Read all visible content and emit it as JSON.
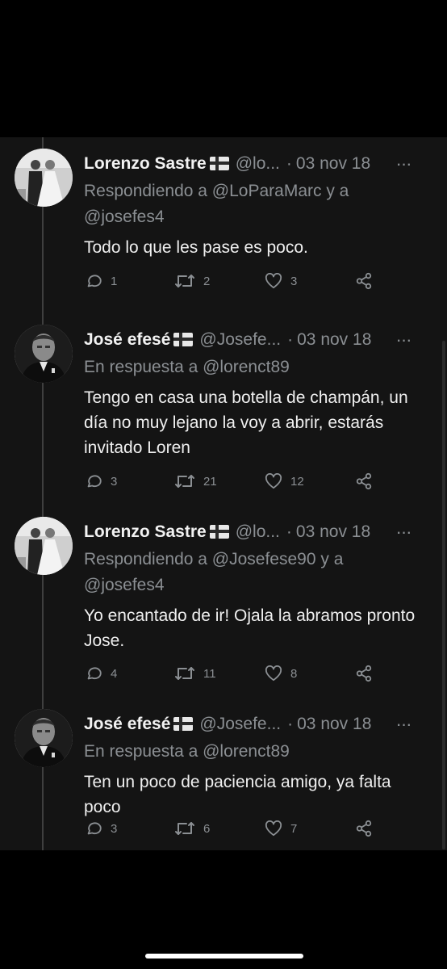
{
  "tweets": [
    {
      "name": "Lorenzo Sastre",
      "handle": "@lo...",
      "dot": "·",
      "date": "03 nov 18",
      "more": "···",
      "reply_context": [
        "Respondiendo a @LoParaMarc y a",
        "@josefes4"
      ],
      "text": "Todo lo que les pase es poco.",
      "replies": "1",
      "retweets": "2",
      "likes": "3"
    },
    {
      "name": "José efesé",
      "handle": "@Josefe...",
      "dot": "·",
      "date": "03 nov 18",
      "more": "···",
      "reply_context": [
        "En respuesta a @lorenct89"
      ],
      "text": "Tengo en casa una botella de champán, un día no muy lejano la voy a abrir, estarás invitado Loren",
      "replies": "3",
      "retweets": "21",
      "likes": "12"
    },
    {
      "name": "Lorenzo Sastre",
      "handle": "@lo...",
      "dot": "·",
      "date": "03 nov 18",
      "more": "···",
      "reply_context": [
        "Respondiendo a @Josefese90 y a",
        "@josefes4"
      ],
      "text": "Yo encantado de ir! Ojala la abramos pronto Jose.",
      "replies": "4",
      "retweets": "11",
      "likes": "8"
    },
    {
      "name": "José efesé",
      "handle": "@Josefe...",
      "dot": "·",
      "date": "03 nov 18",
      "more": "···",
      "reply_context": [
        "En respuesta a @lorenct89"
      ],
      "text": "Ten un poco de paciencia amigo, ya falta poco",
      "replies": "3",
      "retweets": "6",
      "likes": "7"
    }
  ],
  "icons": {
    "reply": "reply-icon",
    "retweet": "retweet-icon",
    "like": "heart-icon",
    "share": "share-icon",
    "flag": "danish-flag-icon"
  },
  "colors": {
    "background": "#000000",
    "panel": "#141414",
    "text": "#efefef",
    "muted": "#8b8f93"
  }
}
